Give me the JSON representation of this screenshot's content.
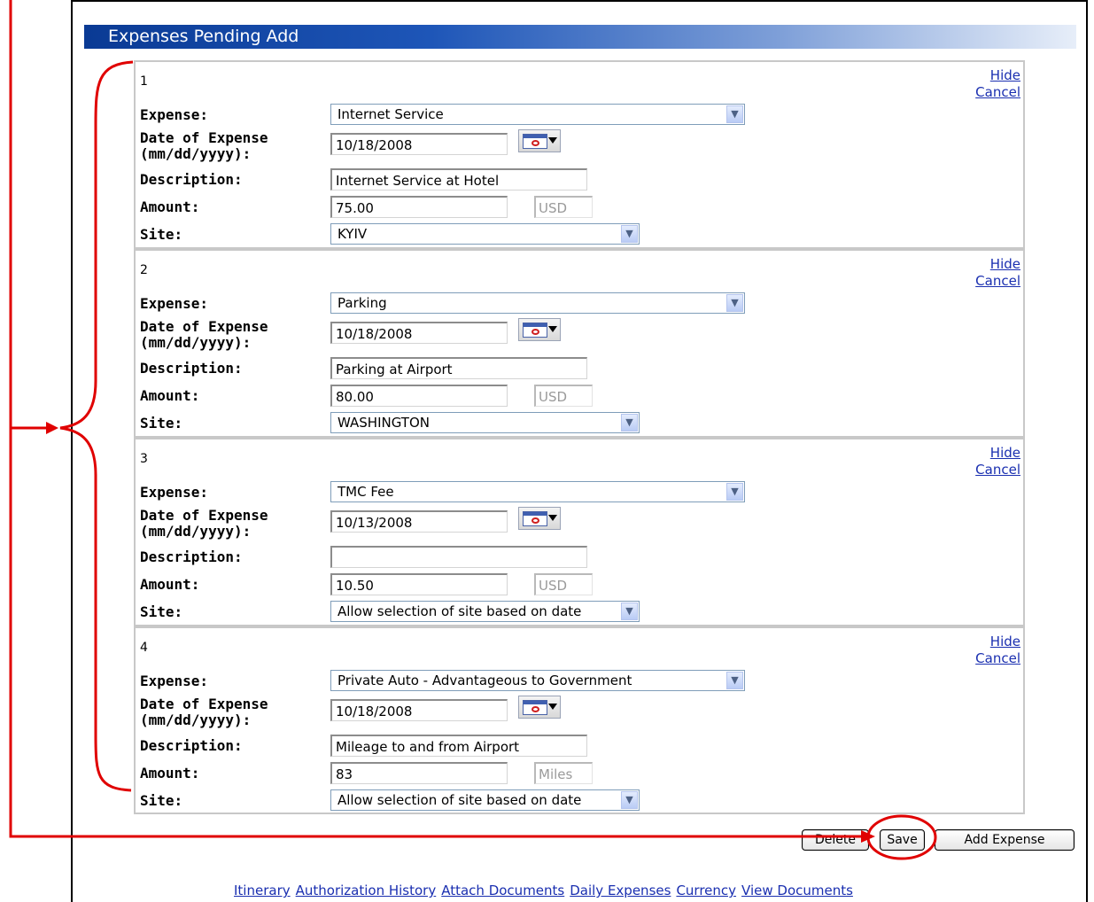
{
  "header": {
    "title": "Expenses Pending Add"
  },
  "expenses": [
    {
      "number": "1",
      "hide": "Hide",
      "cancel": "Cancel",
      "labels": {
        "expense": "Expense:",
        "date_line1": "Date of Expense",
        "date_line2": "(mm/dd/yyyy):",
        "description": "Description:",
        "amount": "Amount:",
        "site": "Site:"
      },
      "expense_type": "Internet Service",
      "date": "10/18/2008",
      "description": "Internet Service at Hotel",
      "amount": "75.00",
      "unit": "USD",
      "site": "KYIV"
    },
    {
      "number": "2",
      "hide": "Hide",
      "cancel": "Cancel",
      "labels": {
        "expense": "Expense:",
        "date_line1": "Date of Expense",
        "date_line2": "(mm/dd/yyyy):",
        "description": "Description:",
        "amount": "Amount:",
        "site": "Site:"
      },
      "expense_type": "Parking",
      "date": "10/18/2008",
      "description": "Parking at Airport",
      "amount": "80.00",
      "unit": "USD",
      "site": "WASHINGTON"
    },
    {
      "number": "3",
      "hide": "Hide",
      "cancel": "Cancel",
      "labels": {
        "expense": "Expense:",
        "date_line1": "Date of Expense",
        "date_line2": "(mm/dd/yyyy):",
        "description": "Description:",
        "amount": "Amount:",
        "site": "Site:"
      },
      "expense_type": "TMC Fee",
      "date": "10/13/2008",
      "description": "",
      "amount": "10.50",
      "unit": "USD",
      "site": "Allow selection of site based on date"
    },
    {
      "number": "4",
      "hide": "Hide",
      "cancel": "Cancel",
      "labels": {
        "expense": "Expense:",
        "date_line1": "Date of Expense",
        "date_line2": "(mm/dd/yyyy):",
        "description": "Description:",
        "amount": "Amount:",
        "site": "Site:"
      },
      "expense_type": "Private Auto - Advantageous to Government",
      "date": "10/18/2008",
      "description": "Mileage to and from Airport",
      "amount": "83",
      "unit": "Miles",
      "site": "Allow selection of site based on date"
    }
  ],
  "buttons": {
    "delete": "Delete",
    "save": "Save",
    "add_expense": "Add Expense"
  },
  "footer_links": [
    "Itinerary",
    "Authorization History",
    "Attach Documents",
    "Daily Expenses",
    "Currency",
    "View Documents"
  ],
  "annotation_color": "#e00000"
}
